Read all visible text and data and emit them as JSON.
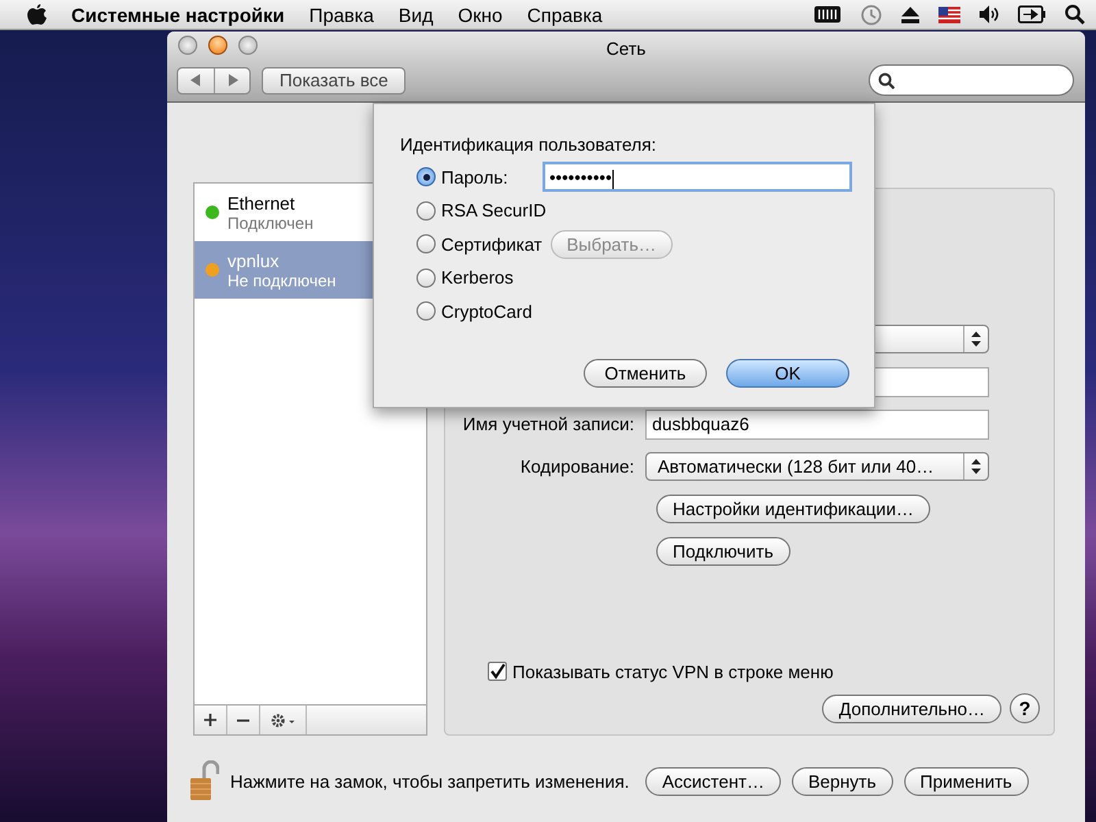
{
  "menubar": {
    "app_name": "Системные настройки",
    "menus": [
      "Правка",
      "Вид",
      "Окно",
      "Справка"
    ]
  },
  "window": {
    "title": "Сеть",
    "show_all_button": "Показать все"
  },
  "services": [
    {
      "name": "Ethernet",
      "status": "Подключен",
      "color": "#3cb81e",
      "selected": false
    },
    {
      "name": "vpnlux",
      "status": "Не подключен",
      "color": "#f0a020",
      "selected": true
    }
  ],
  "panel": {
    "account_label": "Имя учетной записи:",
    "account_value": "dusbbquaz6",
    "encoding_label": "Кодирование:",
    "encoding_value": "Автоматически (128 бит или 40…",
    "auth_settings_button": "Настройки идентификации…",
    "connect_button": "Подключить",
    "show_vpn_status": {
      "label": "Показывать статус VPN в строке меню",
      "checked": true
    },
    "advanced_button": "Дополнительно…",
    "help_button": "?"
  },
  "lock_text": "Нажмите на замок, чтобы запретить изменения.",
  "footer_buttons": [
    "Ассистент…",
    "Вернуть",
    "Применить"
  ],
  "sheet": {
    "title": "Идентификация пользователя:",
    "options": [
      {
        "kind": "password",
        "label": "Пароль:",
        "selected": true,
        "value": "••••••••••"
      },
      {
        "kind": "plain",
        "label": "RSA SecurID",
        "selected": false
      },
      {
        "kind": "choose",
        "label": "Сертификат",
        "selected": false,
        "button": "Выбрать…",
        "disabled": true
      },
      {
        "kind": "plain",
        "label": "Kerberos",
        "selected": false
      },
      {
        "kind": "plain",
        "label": "CryptoCard",
        "selected": false
      }
    ],
    "buttons": [
      {
        "label": "Отменить",
        "default": false
      },
      {
        "label": "OK",
        "default": true
      }
    ]
  }
}
